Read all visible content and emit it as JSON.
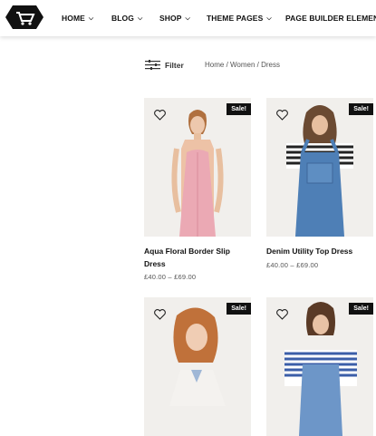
{
  "header": {
    "logo": "cart-logo",
    "nav": [
      {
        "label": "HOME",
        "dropdown": true
      },
      {
        "label": "BLOG",
        "dropdown": true
      },
      {
        "label": "SHOP",
        "dropdown": true
      },
      {
        "label": "THEME PAGES",
        "dropdown": true
      },
      {
        "label": "PAGE BUILDER ELEMENT",
        "dropdown": false
      }
    ]
  },
  "toolbar": {
    "filter_label": "Filter",
    "breadcrumb": "Home / Women / Dress"
  },
  "products": [
    {
      "name": "Aqua Floral Border Slip Dress",
      "price": "£40.00 – £69.00",
      "badge": "Sale!"
    },
    {
      "name": "Denim Utility Top Dress",
      "price": "£40.00 – £69.00",
      "badge": "Sale!"
    },
    {
      "name": "",
      "price": "",
      "badge": "Sale!"
    },
    {
      "name": "",
      "price": "",
      "badge": "Sale!"
    }
  ],
  "colors": {
    "badge_bg": "#111111",
    "accent": "#111111"
  }
}
